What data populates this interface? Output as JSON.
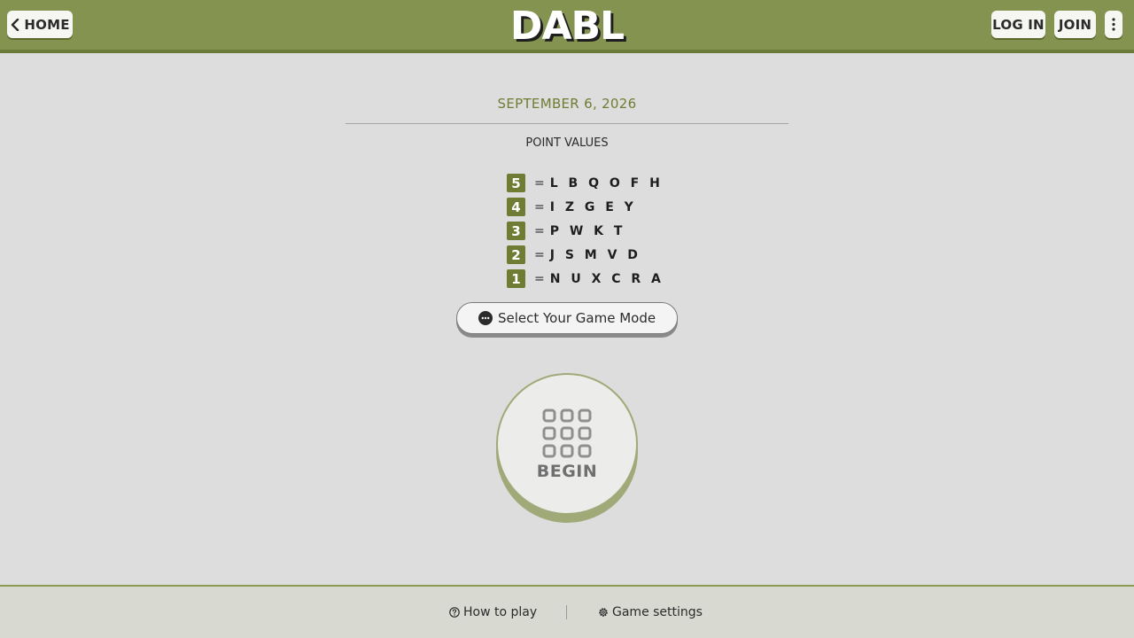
{
  "header": {
    "home_label": "HOME",
    "logo": "DABL",
    "login_label": "LOG IN",
    "join_label": "JOIN",
    "more_icon": "vertical-dots-icon"
  },
  "main": {
    "date": "SEPTEMBER 6, 2026",
    "point_values_title": "POINT VALUES",
    "point_values": [
      {
        "points": "5",
        "eq": "=",
        "letters": "L B Q O F H"
      },
      {
        "points": "4",
        "eq": "=",
        "letters": "I Z G E Y"
      },
      {
        "points": "3",
        "eq": "=",
        "letters": "P W K T"
      },
      {
        "points": "2",
        "eq": "=",
        "letters": "J S M V D"
      },
      {
        "points": "1",
        "eq": "=",
        "letters": "N U X C R A"
      }
    ],
    "mode_button_label": "Select Your Game Mode",
    "begin_label": "BEGIN"
  },
  "footer": {
    "how_to_play": "How to play",
    "game_settings": "Game settings"
  },
  "colors": {
    "header_bg": "#84934f",
    "accent": "#6e7d33",
    "begin_ring": "#a0aa78"
  }
}
